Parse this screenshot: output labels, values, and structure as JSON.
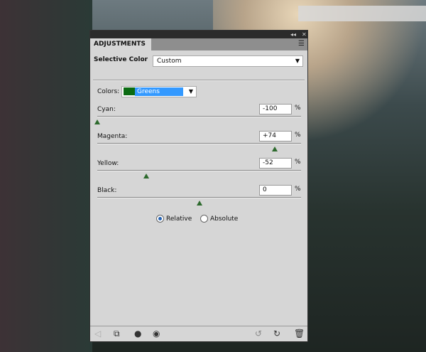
{
  "panel": {
    "title": "ADJUSTMENTS",
    "adjustment_label": "Selective Color",
    "preset": "Custom",
    "colors_label": "Colors:",
    "colors_value": "Greens",
    "swatch": "#0b6b12",
    "sliders": [
      {
        "label": "Cyan:",
        "value": "-100",
        "pct": "%",
        "fraction": 0.0
      },
      {
        "label": "Magenta:",
        "value": "+74",
        "pct": "%",
        "fraction": 0.87
      },
      {
        "label": "Yellow:",
        "value": "-52",
        "pct": "%",
        "fraction": 0.24
      },
      {
        "label": "Black:",
        "value": "0",
        "pct": "%",
        "fraction": 0.5
      }
    ],
    "relative": "Relative",
    "absolute": "Absolute"
  }
}
